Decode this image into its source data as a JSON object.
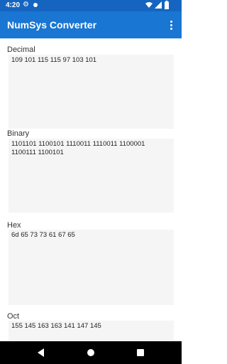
{
  "status_bar": {
    "time": "4:20",
    "icons": [
      "gear-icon",
      "circle-icon",
      "wifi-icon",
      "signal-icon",
      "battery-icon"
    ]
  },
  "app_bar": {
    "title": "NumSys Converter"
  },
  "fields": {
    "decimal": {
      "label": "Decimal",
      "value": "109 101 115 115 97 103 101"
    },
    "binary": {
      "label": "Binary",
      "value": "1101101 1100101 1110011 1110011 1100001 1100111 1100101"
    },
    "hex": {
      "label": "Hex",
      "value": "6d 65 73 73 61 67 65"
    },
    "oct": {
      "label": "Oct",
      "value": "155 145 163 163 141 147 145"
    }
  },
  "colors": {
    "status_bar": "#1565c0",
    "app_bar": "#1976d2",
    "field_bg": "#f5f5f5",
    "nav_bar": "#000000"
  }
}
